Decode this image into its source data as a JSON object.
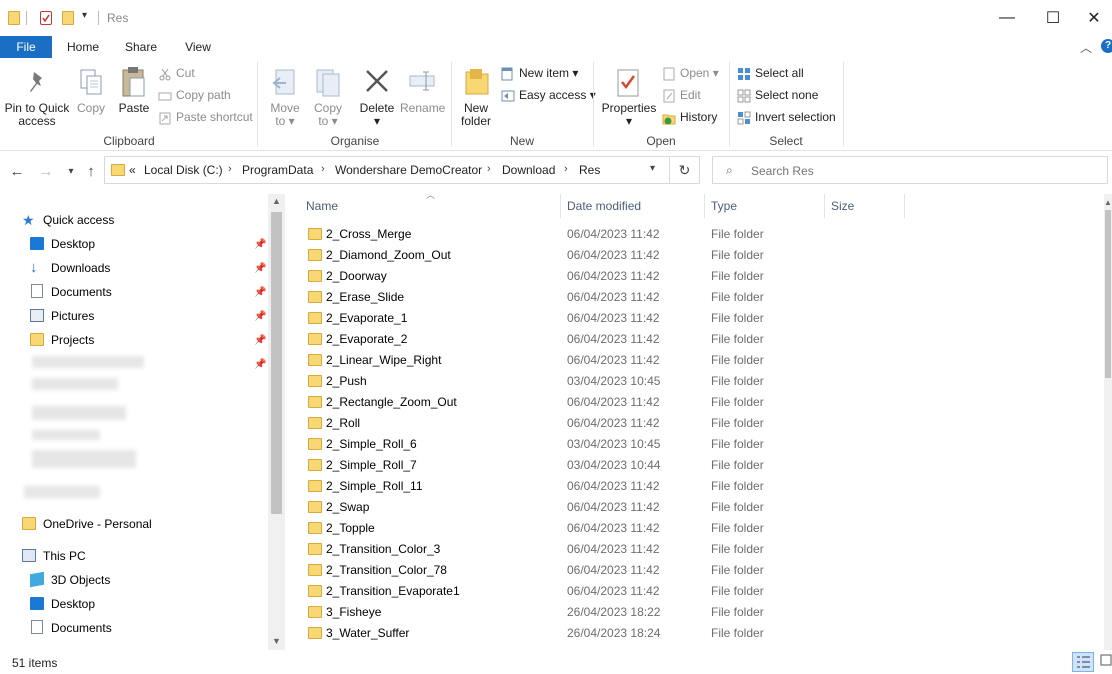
{
  "window": {
    "title": "Res"
  },
  "ribbon_tabs": [
    "File",
    "Home",
    "Share",
    "View"
  ],
  "ribbon": {
    "clipboard": {
      "label": "Clipboard",
      "pin": "Pin to Quick access",
      "copy": "Copy",
      "paste": "Paste",
      "cut": "Cut",
      "copy_path": "Copy path",
      "paste_shortcut": "Paste shortcut"
    },
    "organise": {
      "label": "Organise",
      "move_to": "Move to",
      "copy_to": "Copy to",
      "delete": "Delete",
      "rename": "Rename"
    },
    "new": {
      "label": "New",
      "new_folder": "New folder",
      "new_item": "New item",
      "easy_access": "Easy access"
    },
    "open": {
      "label": "Open",
      "properties": "Properties",
      "open": "Open",
      "edit": "Edit",
      "history": "History"
    },
    "select": {
      "label": "Select",
      "select_all": "Select all",
      "select_none": "Select none",
      "invert_selection": "Invert selection"
    }
  },
  "address": {
    "crumbs": [
      "Local Disk (C:)",
      "ProgramData",
      "Wondershare DemoCreator",
      "Download",
      "Res"
    ],
    "overflow": "«"
  },
  "search": {
    "placeholder": "Search Res"
  },
  "navpane": {
    "quick_access": "Quick access",
    "pinned": [
      "Desktop",
      "Downloads",
      "Documents",
      "Pictures",
      "Projects"
    ],
    "onedrive": "OneDrive - Personal",
    "this_pc": "This PC",
    "pc_items": [
      "3D Objects",
      "Desktop",
      "Documents"
    ]
  },
  "columns": {
    "name": "Name",
    "date": "Date modified",
    "type": "Type",
    "size": "Size"
  },
  "files": [
    {
      "name": "2_Cross_Merge",
      "date": "06/04/2023 11:42",
      "type": "File folder"
    },
    {
      "name": "2_Diamond_Zoom_Out",
      "date": "06/04/2023 11:42",
      "type": "File folder"
    },
    {
      "name": "2_Doorway",
      "date": "06/04/2023 11:42",
      "type": "File folder"
    },
    {
      "name": "2_Erase_Slide",
      "date": "06/04/2023 11:42",
      "type": "File folder"
    },
    {
      "name": "2_Evaporate_1",
      "date": "06/04/2023 11:42",
      "type": "File folder"
    },
    {
      "name": "2_Evaporate_2",
      "date": "06/04/2023 11:42",
      "type": "File folder"
    },
    {
      "name": "2_Linear_Wipe_Right",
      "date": "06/04/2023 11:42",
      "type": "File folder"
    },
    {
      "name": "2_Push",
      "date": "03/04/2023 10:45",
      "type": "File folder"
    },
    {
      "name": "2_Rectangle_Zoom_Out",
      "date": "06/04/2023 11:42",
      "type": "File folder"
    },
    {
      "name": "2_Roll",
      "date": "06/04/2023 11:42",
      "type": "File folder"
    },
    {
      "name": "2_Simple_Roll_6",
      "date": "03/04/2023 10:45",
      "type": "File folder"
    },
    {
      "name": "2_Simple_Roll_7",
      "date": "03/04/2023 10:44",
      "type": "File folder"
    },
    {
      "name": "2_Simple_Roll_11",
      "date": "06/04/2023 11:42",
      "type": "File folder"
    },
    {
      "name": "2_Swap",
      "date": "06/04/2023 11:42",
      "type": "File folder"
    },
    {
      "name": "2_Topple",
      "date": "06/04/2023 11:42",
      "type": "File folder"
    },
    {
      "name": "2_Transition_Color_3",
      "date": "06/04/2023 11:42",
      "type": "File folder"
    },
    {
      "name": "2_Transition_Color_78",
      "date": "06/04/2023 11:42",
      "type": "File folder"
    },
    {
      "name": "2_Transition_Evaporate1",
      "date": "06/04/2023 11:42",
      "type": "File folder"
    },
    {
      "name": "3_Fisheye",
      "date": "26/04/2023 18:22",
      "type": "File folder"
    },
    {
      "name": "3_Water_Suffer",
      "date": "26/04/2023 18:24",
      "type": "File folder"
    }
  ],
  "status": {
    "count": "51 items"
  }
}
